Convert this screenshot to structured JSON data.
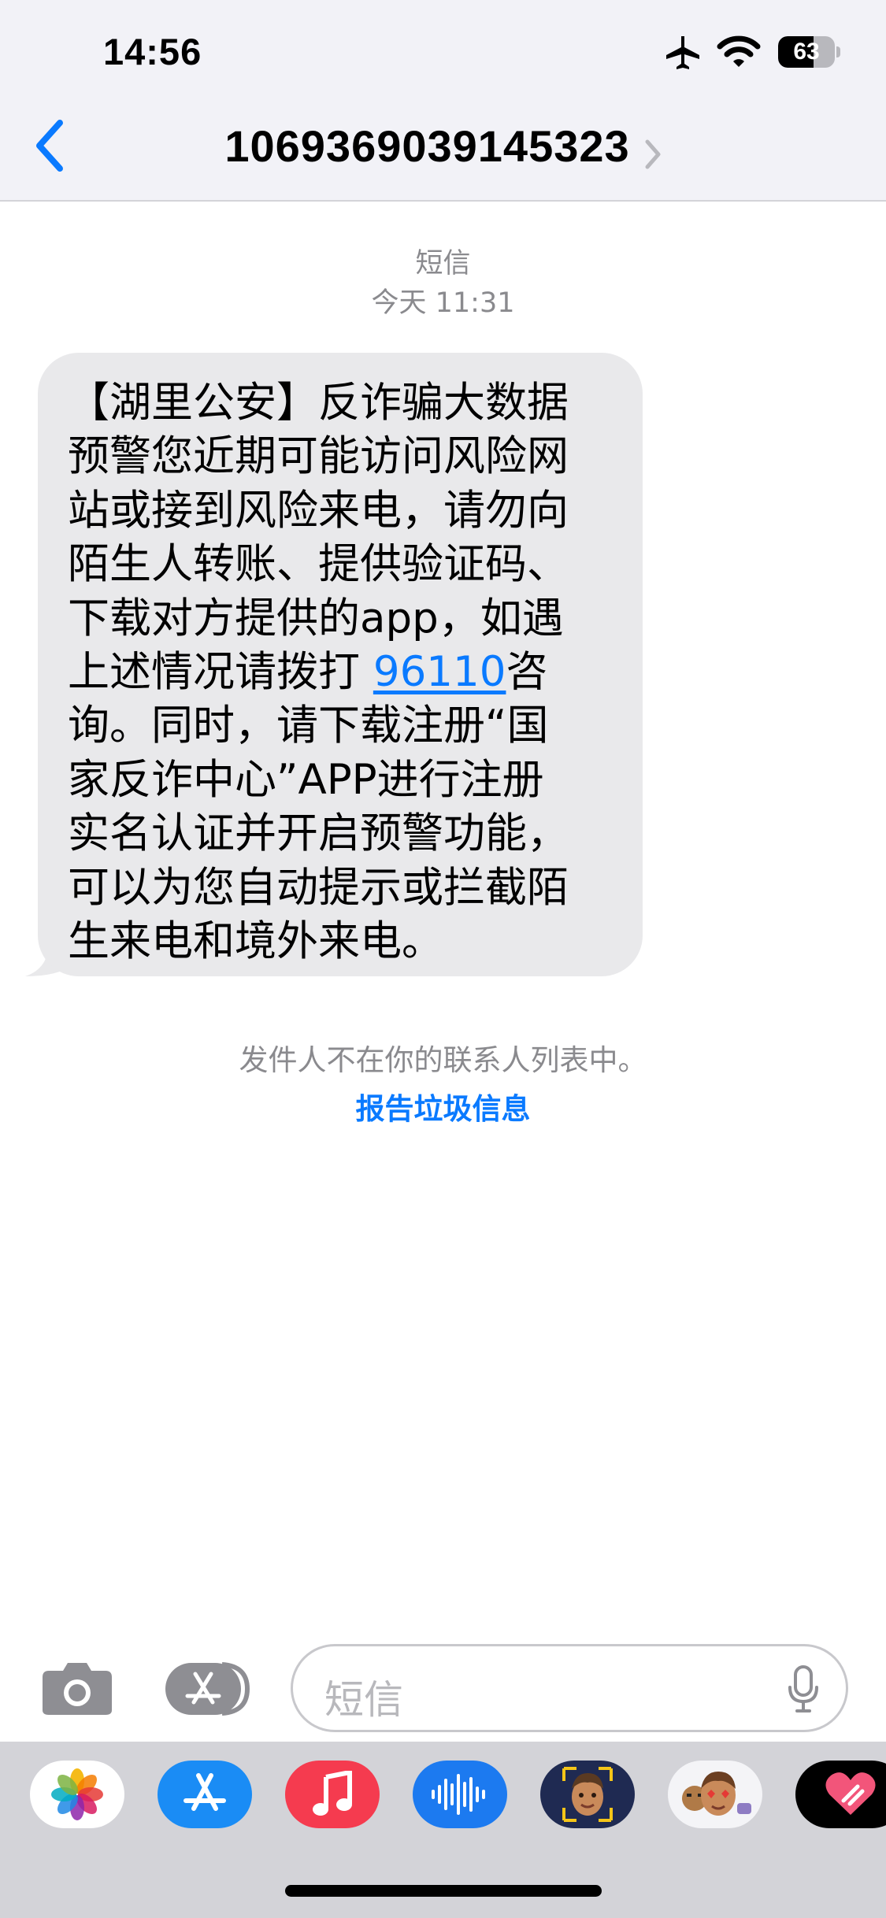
{
  "status_bar": {
    "time": "14:56",
    "battery_level": "63",
    "battery_fraction": 0.63,
    "icons": [
      "airplane-icon",
      "wifi-icon",
      "battery-icon"
    ]
  },
  "nav": {
    "title": "1069369039145323",
    "back_icon": "chevron-left-icon",
    "detail_icon": "chevron-right-icon"
  },
  "thread": {
    "message_type": "短信",
    "timestamp": "今天 11:31",
    "message": {
      "lines": [
        "【湖里公安】反诈骗大数据",
        "预警您近期可能访问风险网",
        "站或接到风险来电，请勿向",
        "陌生人转账、提供验证码、",
        "下载对方提供的app，如遇",
        "上述情况请拨打 ",
        "96110",
        "咨",
        "询。同时，请下载注册“国",
        "家反诈中心”APP进行注册",
        "实名认证并开启预警功能，",
        "可以为您自动提示或拦截陌",
        "生来电和境外来电。"
      ]
    },
    "sender_notice": "发件人不在你的联系人列表中。",
    "report_label": "报告垃圾信息"
  },
  "input_bar": {
    "placeholder": "短信",
    "camera_icon": "camera-icon",
    "apps_icon": "app-store-icon",
    "mic_icon": "microphone-icon"
  },
  "app_drawer": {
    "apps": [
      "photos-icon",
      "app-store-icon",
      "music-icon",
      "audio-message-icon",
      "memoji-icon",
      "memoji-stickers-icon",
      "digital-touch-icon"
    ]
  },
  "colors": {
    "accent": "#0a7aff",
    "bubble": "#e9e9eb",
    "header_bg": "#f2f2f7",
    "drawer_bg": "#d3d3d8"
  }
}
